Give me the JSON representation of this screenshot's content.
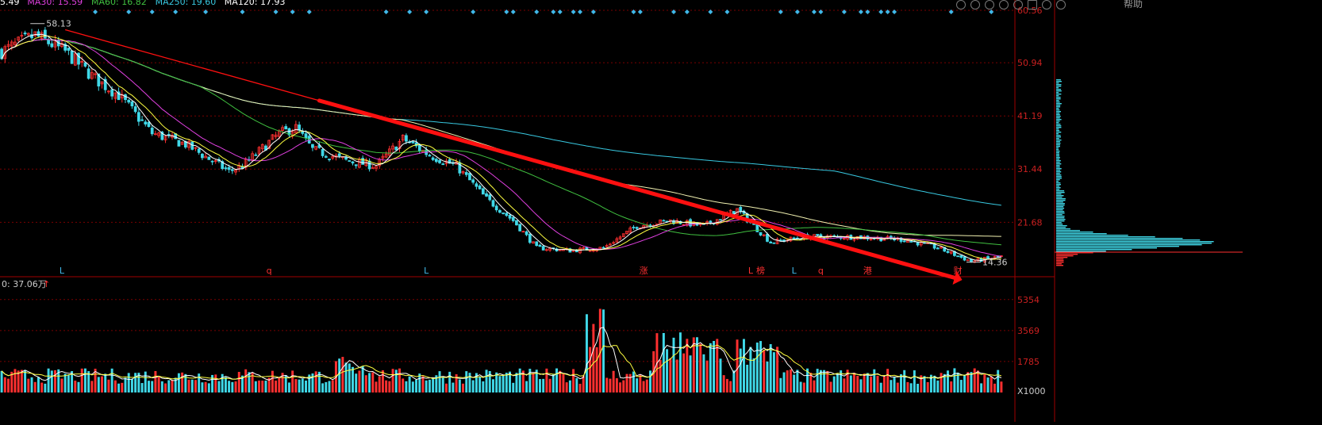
{
  "header": {
    "ma_legend": [
      {
        "label": "5.49",
        "color": "#ffffff"
      },
      {
        "label": "MA30: 15.59",
        "color": "#e040e0"
      },
      {
        "label": "MA60: 16.82",
        "color": "#40c040"
      },
      {
        "label": "MA250: 19.60",
        "color": "#38c8e0"
      },
      {
        "label": "MA120: 17.93",
        "color": "#ffffff"
      }
    ],
    "help_label": "帮助"
  },
  "colors": {
    "up": "#ff3030",
    "down": "#40d8e8",
    "grid": "#7a0000",
    "axis_text": "#cc2020",
    "trendline": "#ff1010",
    "ma5": "#ffffff",
    "ma10": "#ffff40",
    "ma20": "#e040e0",
    "ma60": "#40c040",
    "ma120": "#f0f0b0",
    "ma250": "#38c8e0",
    "marker": "#40b8e8"
  },
  "toolbar_icons": [
    "eye-icon",
    "settings-icon",
    "help-icon",
    "circle-icon",
    "refresh-icon",
    "square-icon",
    "zoom-in-icon",
    "zoom-out-icon"
  ],
  "chart_data": [
    {
      "type": "line",
      "name": "price-panel",
      "y_ticks": [
        "60.56",
        "50.94",
        "41.19",
        "31.44",
        "21.68"
      ],
      "ylim": [
        13,
        61
      ],
      "x": {
        "count": 300
      },
      "annotations": [
        {
          "text": "58.13",
          "index": 10,
          "value": 58.13
        },
        {
          "text": "14.36",
          "index": 290,
          "value": 14.36
        }
      ],
      "event_markers": [
        {
          "text": "L",
          "index": 18,
          "color": "#40b8e8"
        },
        {
          "text": "q",
          "index": 80,
          "color": "#ff3030"
        },
        {
          "text": "L",
          "index": 127,
          "color": "#40b8e8"
        },
        {
          "text": "涨",
          "index": 192,
          "color": "#ff3030"
        },
        {
          "text": "L",
          "index": 224,
          "color": "#ff3030"
        },
        {
          "text": "榜",
          "index": 227,
          "color": "#ff3030"
        },
        {
          "text": "L",
          "index": 237,
          "color": "#40b8e8"
        },
        {
          "text": "q",
          "index": 245,
          "color": "#ff3030"
        },
        {
          "text": "港",
          "index": 259,
          "color": "#ff3030"
        },
        {
          "text": "财",
          "index": 286,
          "color": "#ff3030"
        }
      ],
      "trendline": {
        "from": {
          "index": 19,
          "value": 57.0
        },
        "to": {
          "index": 285,
          "value": 11.5
        }
      },
      "profile_ref_value": 16.2
    },
    {
      "type": "bar",
      "name": "volume-panel",
      "header": "0: 37.06万",
      "header_arrow": "↑",
      "y_ticks": [
        "5354",
        "3569",
        "1785"
      ],
      "unit": "X1000",
      "ylim": [
        0,
        5800
      ]
    }
  ]
}
